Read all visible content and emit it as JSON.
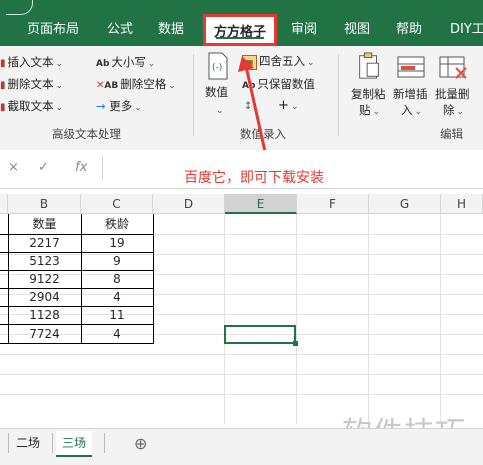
{
  "tabs": [
    {
      "label": "页面布局",
      "active": false
    },
    {
      "label": "公式",
      "active": false
    },
    {
      "label": "数据",
      "active": false
    },
    {
      "label": "方方格子",
      "active": true
    },
    {
      "label": "审阅",
      "active": false
    },
    {
      "label": "视图",
      "active": false
    },
    {
      "label": "帮助",
      "active": false
    },
    {
      "label": "DIY工",
      "active": false
    }
  ],
  "ribbon": {
    "text_group": {
      "insert_text": "插入文本",
      "delete_text": "删除文本",
      "extract_text": "截取文本",
      "case": "大小写",
      "case_icon": "Ab",
      "delete_spaces": "删除空格",
      "spaces_icon": "AB",
      "more": "更多",
      "label": "高级文本处理"
    },
    "number_group": {
      "value": "数值",
      "round": "四舍五入",
      "keep_values": "只保留数值",
      "keep_icon": "Ab",
      "label": "数值录入"
    },
    "edit_group": {
      "copy_paste_line1": "复制粘",
      "copy_paste_line2": "贴",
      "new_insert_line1": "新增插",
      "new_insert_line2": "入",
      "batch_delete_line1": "批量删",
      "batch_delete_line2": "除",
      "label": "编辑"
    }
  },
  "formula_bar": {
    "cancel": "×",
    "confirm": "✓",
    "fx": "fx",
    "value": ""
  },
  "annotation": {
    "text": "百度它，即可下载安装",
    "color": "#e53935"
  },
  "columns": [
    "B",
    "C",
    "D",
    "E",
    "F",
    "G",
    "H"
  ],
  "selected_column": "E",
  "table": {
    "headers": [
      "数量",
      "秩龄"
    ],
    "rows": [
      [
        "2217",
        "19"
      ],
      [
        "5123",
        "9"
      ],
      [
        "9122",
        "8"
      ],
      [
        "2904",
        "4"
      ],
      [
        "1128",
        "11"
      ],
      [
        "7724",
        "4"
      ]
    ]
  },
  "sheets": [
    {
      "label": "二场",
      "active": false
    },
    {
      "label": "三场",
      "active": true
    }
  ],
  "add_sheet": "⊕",
  "watermark": "软件技巧",
  "colors": {
    "accent": "#217346",
    "highlight": "#e53935"
  }
}
